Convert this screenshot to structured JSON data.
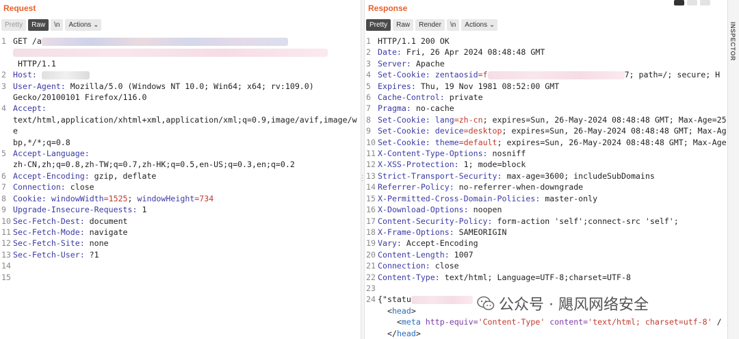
{
  "request": {
    "title": "Request",
    "tabs": [
      "Pretty",
      "Raw",
      "\\n",
      "Actions"
    ],
    "lines": [
      {
        "n": "1",
        "parts": [
          {
            "t": "GET /a",
            "c": ""
          },
          {
            "blur": "360"
          }
        ]
      },
      {
        "n": "",
        "parts": [
          {
            "blur": "460",
            "style": "pink"
          }
        ]
      },
      {
        "n": "",
        "parts": [
          {
            "t": " HTTP/1.1",
            "c": ""
          }
        ]
      },
      {
        "n": "2",
        "parts": [
          {
            "t": "Host:",
            "c": "k"
          },
          {
            "t": " ",
            "c": ""
          },
          {
            "blur": "70",
            "style": "grey"
          }
        ]
      },
      {
        "n": "3",
        "parts": [
          {
            "t": "User-Agent:",
            "c": "k"
          },
          {
            "t": " Mozilla/5.0 (Windows NT 10.0; Win64; x64; rv:109.0)",
            "c": ""
          }
        ]
      },
      {
        "n": "",
        "parts": [
          {
            "t": "Gecko/20100101 Firefox/116.0",
            "c": ""
          }
        ]
      },
      {
        "n": "4",
        "parts": [
          {
            "t": "Accept:",
            "c": "k"
          }
        ]
      },
      {
        "n": "",
        "parts": [
          {
            "t": "text/html,application/xhtml+xml,application/xml;q=0.9,image/avif,image/we",
            "c": ""
          }
        ]
      },
      {
        "n": "",
        "parts": [
          {
            "t": "bp,*/*;q=0.8",
            "c": ""
          }
        ]
      },
      {
        "n": "5",
        "parts": [
          {
            "t": "Accept-Language:",
            "c": "k"
          }
        ]
      },
      {
        "n": "",
        "parts": [
          {
            "t": "zh-CN,zh;q=0.8,zh-TW;q=0.7,zh-HK;q=0.5,en-US;q=0.3,en;q=0.2",
            "c": ""
          }
        ]
      },
      {
        "n": "6",
        "parts": [
          {
            "t": "Accept-Encoding:",
            "c": "k"
          },
          {
            "t": " gzip, deflate",
            "c": ""
          }
        ]
      },
      {
        "n": "7",
        "parts": [
          {
            "t": "Connection:",
            "c": "k"
          },
          {
            "t": " close",
            "c": ""
          }
        ]
      },
      {
        "n": "8",
        "parts": [
          {
            "t": "Cookie:",
            "c": "k"
          },
          {
            "t": " windowWidth",
            "c": "k"
          },
          {
            "t": "=1525",
            "c": "v"
          },
          {
            "t": "; ",
            "c": ""
          },
          {
            "t": "windowHeight",
            "c": "k"
          },
          {
            "t": "=734",
            "c": "v"
          }
        ]
      },
      {
        "n": "9",
        "parts": [
          {
            "t": "Upgrade-Insecure-Requests:",
            "c": "k"
          },
          {
            "t": " 1",
            "c": ""
          }
        ]
      },
      {
        "n": "10",
        "parts": [
          {
            "t": "Sec-Fetch-Dest:",
            "c": "k"
          },
          {
            "t": " document",
            "c": ""
          }
        ]
      },
      {
        "n": "11",
        "parts": [
          {
            "t": "Sec-Fetch-Mode:",
            "c": "k"
          },
          {
            "t": " navigate",
            "c": ""
          }
        ]
      },
      {
        "n": "12",
        "parts": [
          {
            "t": "Sec-Fetch-Site:",
            "c": "k"
          },
          {
            "t": " none",
            "c": ""
          }
        ]
      },
      {
        "n": "13",
        "parts": [
          {
            "t": "Sec-Fetch-User:",
            "c": "k"
          },
          {
            "t": " ?1",
            "c": ""
          }
        ]
      },
      {
        "n": "14",
        "parts": []
      },
      {
        "n": "15",
        "parts": []
      }
    ]
  },
  "response": {
    "title": "Response",
    "tabs": [
      "Pretty",
      "Raw",
      "Render",
      "\\n",
      "Actions"
    ],
    "lines": [
      {
        "n": "1",
        "parts": [
          {
            "t": "HTTP/1.1 200 OK",
            "c": ""
          }
        ]
      },
      {
        "n": "2",
        "parts": [
          {
            "t": "Date:",
            "c": "k"
          },
          {
            "t": " Fri, 26 Apr 2024 08:48:48 GMT",
            "c": ""
          }
        ]
      },
      {
        "n": "3",
        "parts": [
          {
            "t": "Server:",
            "c": "k"
          },
          {
            "t": " Apache",
            "c": ""
          }
        ]
      },
      {
        "n": "4",
        "parts": [
          {
            "t": "Set-Cookie:",
            "c": "k"
          },
          {
            "t": " zentaosid",
            "c": "k"
          },
          {
            "t": "=f",
            "c": "v"
          },
          {
            "blur": "200",
            "style": "pink"
          },
          {
            "t": "7; path=/; secure; H",
            "c": ""
          }
        ]
      },
      {
        "n": "5",
        "parts": [
          {
            "t": "Expires:",
            "c": "k"
          },
          {
            "t": " Thu, 19 Nov 1981 08:52:00 GMT",
            "c": ""
          }
        ]
      },
      {
        "n": "6",
        "parts": [
          {
            "t": "Cache-Control:",
            "c": "k"
          },
          {
            "t": " private",
            "c": ""
          }
        ]
      },
      {
        "n": "7",
        "parts": [
          {
            "t": "Pragma:",
            "c": "k"
          },
          {
            "t": " no-cache",
            "c": ""
          }
        ]
      },
      {
        "n": "8",
        "parts": [
          {
            "t": "Set-Cookie:",
            "c": "k"
          },
          {
            "t": " lang",
            "c": "k"
          },
          {
            "t": "=zh-cn",
            "c": "v"
          },
          {
            "t": "; expires=Sun, 26-May-2024 08:48:48 GMT; Max-Age=25",
            "c": ""
          }
        ]
      },
      {
        "n": "9",
        "parts": [
          {
            "t": "Set-Cookie:",
            "c": "k"
          },
          {
            "t": " device",
            "c": "k"
          },
          {
            "t": "=desktop",
            "c": "v"
          },
          {
            "t": "; expires=Sun, 26-May-2024 08:48:48 GMT; Max-Ag",
            "c": ""
          }
        ]
      },
      {
        "n": "10",
        "parts": [
          {
            "t": "Set-Cookie:",
            "c": "k"
          },
          {
            "t": " theme",
            "c": "k"
          },
          {
            "t": "=default",
            "c": "v"
          },
          {
            "t": "; expires=Sun, 26-May-2024 08:48:48 GMT; Max-Age",
            "c": ""
          }
        ]
      },
      {
        "n": "11",
        "parts": [
          {
            "t": "X-Content-Type-Options:",
            "c": "k"
          },
          {
            "t": " nosniff",
            "c": ""
          }
        ]
      },
      {
        "n": "12",
        "parts": [
          {
            "t": "X-XSS-Protection:",
            "c": "k"
          },
          {
            "t": " 1; mode=block",
            "c": ""
          }
        ]
      },
      {
        "n": "13",
        "parts": [
          {
            "t": "Strict-Transport-Security:",
            "c": "k"
          },
          {
            "t": " max-age=3600; includeSubDomains",
            "c": ""
          }
        ]
      },
      {
        "n": "14",
        "parts": [
          {
            "t": "Referrer-Policy:",
            "c": "k"
          },
          {
            "t": " no-referrer-when-downgrade",
            "c": ""
          }
        ]
      },
      {
        "n": "15",
        "parts": [
          {
            "t": "X-Permitted-Cross-Domain-Policies:",
            "c": "k"
          },
          {
            "t": " master-only",
            "c": ""
          }
        ]
      },
      {
        "n": "16",
        "parts": [
          {
            "t": "X-Download-Options:",
            "c": "k"
          },
          {
            "t": " noopen",
            "c": ""
          }
        ]
      },
      {
        "n": "17",
        "parts": [
          {
            "t": "Content-Security-Policy:",
            "c": "k"
          },
          {
            "t": " form-action 'self';connect-src 'self';",
            "c": ""
          }
        ]
      },
      {
        "n": "18",
        "parts": [
          {
            "t": "X-Frame-Options:",
            "c": "k"
          },
          {
            "t": " SAMEORIGIN",
            "c": ""
          }
        ]
      },
      {
        "n": "19",
        "parts": [
          {
            "t": "Vary:",
            "c": "k"
          },
          {
            "t": " Accept-Encoding",
            "c": ""
          }
        ]
      },
      {
        "n": "20",
        "parts": [
          {
            "t": "Content-Length:",
            "c": "k"
          },
          {
            "t": " 1007",
            "c": ""
          }
        ]
      },
      {
        "n": "21",
        "parts": [
          {
            "t": "Connection:",
            "c": "k"
          },
          {
            "t": " close",
            "c": ""
          }
        ]
      },
      {
        "n": "22",
        "parts": [
          {
            "t": "Content-Type:",
            "c": "k"
          },
          {
            "t": " text/html; Language=UTF-8;charset=UTF-8",
            "c": ""
          }
        ]
      },
      {
        "n": "23",
        "parts": []
      },
      {
        "n": "24",
        "parts": [
          {
            "t": "{\"statu",
            "c": ""
          },
          {
            "blur": "90",
            "style": "pink"
          }
        ]
      },
      {
        "n": "",
        "parts": [
          {
            "t": "  <",
            "c": ""
          },
          {
            "t": "head",
            "c": "html-tag"
          },
          {
            "t": ">",
            "c": ""
          }
        ]
      },
      {
        "n": "",
        "parts": [
          {
            "t": "    <",
            "c": ""
          },
          {
            "t": "meta",
            "c": "html-tag"
          },
          {
            "t": " http-equiv=",
            "c": "html-attr"
          },
          {
            "t": "'Content-Type'",
            "c": "html-str"
          },
          {
            "t": " content=",
            "c": "html-attr"
          },
          {
            "t": "'text/html; charset=utf-8'",
            "c": "html-str"
          },
          {
            "t": " /",
            "c": ""
          }
        ]
      },
      {
        "n": "",
        "parts": [
          {
            "t": "  </",
            "c": ""
          },
          {
            "t": "head",
            "c": "html-tag"
          },
          {
            "t": ">",
            "c": ""
          }
        ]
      }
    ]
  },
  "inspector": {
    "label": "INSPECTOR"
  },
  "watermark": {
    "text": "公众号 · 飓风网络安全"
  }
}
